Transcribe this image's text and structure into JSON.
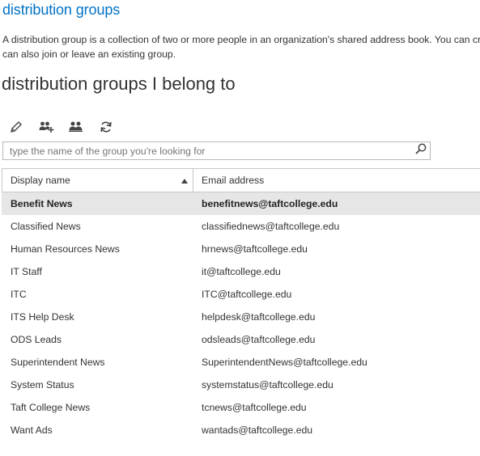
{
  "page": {
    "title": "distribution groups",
    "description_line1": "A distribution group is a collection of two or more people in an organization's shared address book. You can crea",
    "description_line2": "can also join or leave an existing group.",
    "subheading": "distribution groups I belong to"
  },
  "toolbar": {
    "buttons": [
      {
        "name": "edit",
        "icon": "pencil-icon"
      },
      {
        "name": "join",
        "icon": "people-add-icon"
      },
      {
        "name": "leave",
        "icon": "people-icon"
      },
      {
        "name": "refresh",
        "icon": "refresh-icon"
      }
    ]
  },
  "search": {
    "placeholder": "type the name of the group you're looking for",
    "value": ""
  },
  "table": {
    "columns": [
      "Display name",
      "Email address"
    ],
    "sort_column": "Display name",
    "sort_direction": "ascending",
    "rows": [
      {
        "name": "Benefit News",
        "email": "benefitnews@taftcollege.edu",
        "selected": true
      },
      {
        "name": "Classified News",
        "email": "classifiednews@taftcollege.edu",
        "selected": false
      },
      {
        "name": "Human Resources News",
        "email": "hrnews@taftcollege.edu",
        "selected": false
      },
      {
        "name": "IT Staff",
        "email": "it@taftcollege.edu",
        "selected": false
      },
      {
        "name": "ITC",
        "email": "ITC@taftcollege.edu",
        "selected": false
      },
      {
        "name": "ITS Help Desk",
        "email": "helpdesk@taftcollege.edu",
        "selected": false
      },
      {
        "name": "ODS Leads",
        "email": "odsleads@taftcollege.edu",
        "selected": false
      },
      {
        "name": "Superintendent News",
        "email": "SuperintendentNews@taftcollege.edu",
        "selected": false
      },
      {
        "name": "System Status",
        "email": "systemstatus@taftcollege.edu",
        "selected": false
      },
      {
        "name": "Taft College News",
        "email": "tcnews@taftcollege.edu",
        "selected": false
      },
      {
        "name": "Want Ads",
        "email": "wantads@taftcollege.edu",
        "selected": false
      }
    ]
  },
  "colors": {
    "accent": "#0072c6",
    "selected_row": "#e6e6e6",
    "icon": "#444444"
  }
}
